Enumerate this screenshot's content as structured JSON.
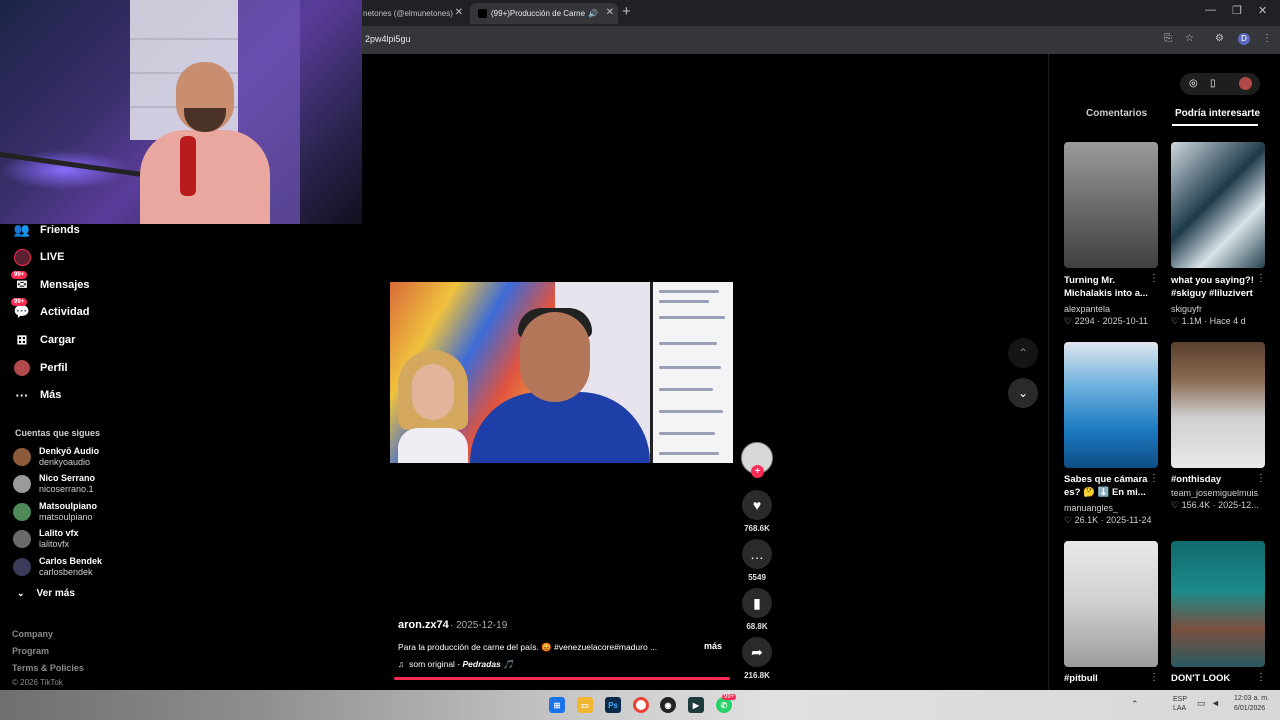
{
  "browser": {
    "tabs": [
      {
        "title": "netones (@elmunetones)"
      },
      {
        "title": "(99+)Producción de Carne"
      }
    ],
    "url": "2pw4lpi5gu",
    "profile_initial": "D"
  },
  "sidebar": {
    "items": [
      {
        "label": "Friends",
        "icon": "friends-icon"
      },
      {
        "label": "LIVE",
        "icon": "live-icon"
      },
      {
        "label": "Mensajes",
        "icon": "messages-icon",
        "badge": "99+"
      },
      {
        "label": "Actividad",
        "icon": "activity-icon",
        "badge": "99+"
      },
      {
        "label": "Cargar",
        "icon": "upload-icon"
      },
      {
        "label": "Perfil",
        "icon": "profile-avatar"
      },
      {
        "label": "Más",
        "icon": "more-icon"
      }
    ],
    "following_heading": "Cuentas que sigues",
    "following": [
      {
        "name": "Denkyō Audio",
        "username": "denkyoaudio",
        "color": "#8a5a3a"
      },
      {
        "name": "Nico Serrano",
        "username": "nicoserrano.1",
        "color": "#9a9a9a"
      },
      {
        "name": "Matsoulpiano",
        "username": "matsoulpiano",
        "color": "#4e8a5a"
      },
      {
        "name": "Lalito vfx",
        "username": "lalitovfx",
        "color": "#6a6a6a"
      },
      {
        "name": "Carlos Bendek",
        "username": "carlosbendek",
        "color": "#3a3a5a"
      }
    ],
    "see_more": "Ver más",
    "footer": [
      "Company",
      "Program",
      "Terms & Policies"
    ],
    "copyright": "© 2026 TikTok"
  },
  "video": {
    "author": "aron.zx74",
    "date": "2025-12-19",
    "description": "Para la producción de carne del  país. 😡 #venezuelacore#maduro ...",
    "more_label": "más",
    "sound_prefix": "som original - ",
    "sound_name": "Pedradas 🎵",
    "progress": 1.0,
    "likes": "768.6K",
    "comments": "5549",
    "saves": "68.8K",
    "shares": "216.8K"
  },
  "right_panel": {
    "tabs": [
      "Comentarios",
      "Podría interesarte"
    ],
    "active_tab": "Podría interesarte",
    "cards": [
      {
        "title": "Turning Mr. Michalakis into a...",
        "author": "alexpantela",
        "likes": "2294",
        "date": "2025-10-11"
      },
      {
        "title": "what you saying?! #skiguy #liluzivert",
        "author": "skiguyfr",
        "likes": "1.1M",
        "date": "Hace 4 d"
      },
      {
        "title": "Sabes que cámara es? 🤔 ⬇️ En mi...",
        "author": "manuangles_",
        "likes": "26.1K",
        "date": "2025-11-24"
      },
      {
        "title": "#onthisday",
        "author": "team_josemiguelmuis...",
        "likes": "156.4K",
        "date": "2025-12..."
      },
      {
        "title": "#pitbull",
        "author": "",
        "likes": "",
        "date": ""
      },
      {
        "title": "DON'T LOOK",
        "author": "",
        "likes": "",
        "date": ""
      }
    ]
  },
  "taskbar": {
    "lang_top": "ESP",
    "lang_bottom": "LAA",
    "time": "12:03 a. m.",
    "date": "6/01/2026",
    "whatsapp_badge": "99+"
  },
  "colors": {
    "accent": "#fe2c55",
    "background": "#000000"
  }
}
